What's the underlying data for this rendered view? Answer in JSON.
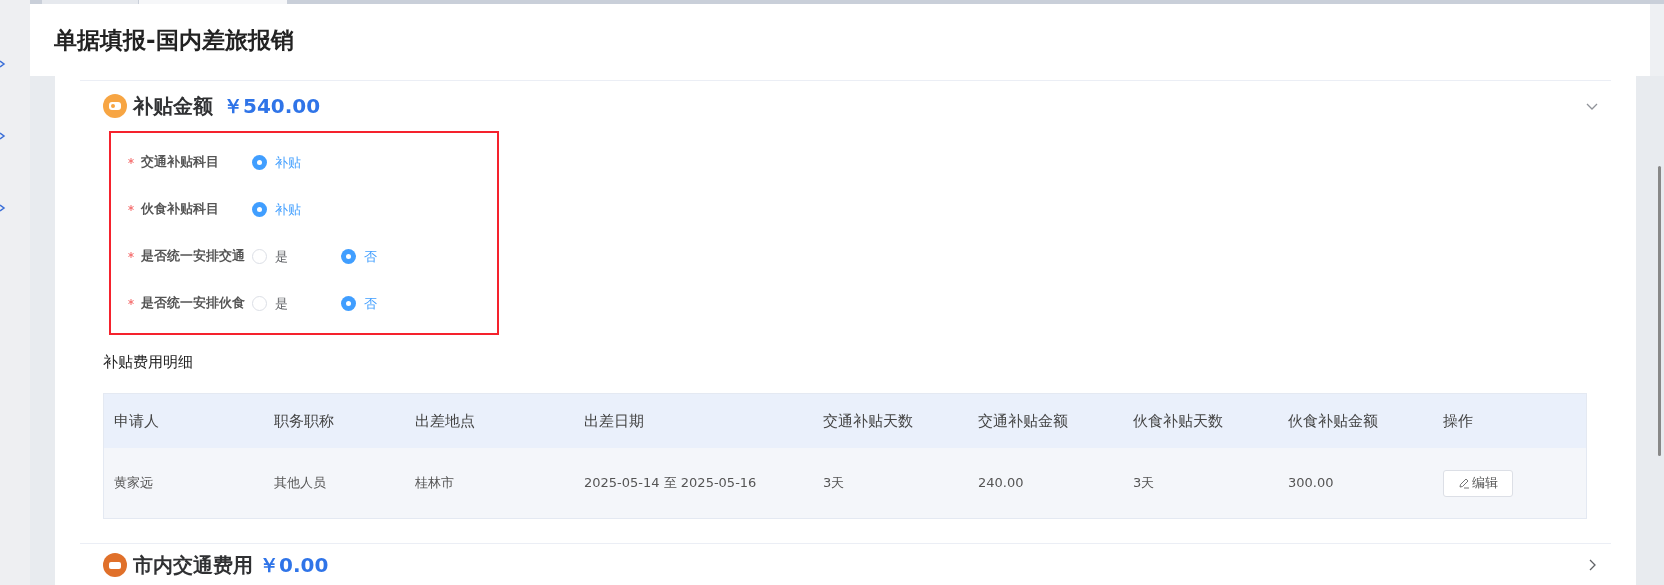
{
  "page": {
    "title": "单据填报-国内差旅报销"
  },
  "subsidy_section": {
    "title": "补贴金额",
    "amount": "￥540.00",
    "expanded": true,
    "fields_highlighted": true,
    "fields": [
      {
        "label": "交通补贴科目",
        "required": true,
        "options": [
          {
            "label": "补贴",
            "selected": true
          }
        ]
      },
      {
        "label": "伙食补贴科目",
        "required": true,
        "options": [
          {
            "label": "补贴",
            "selected": true
          }
        ]
      },
      {
        "label": "是否统一安排交通",
        "required": true,
        "options": [
          {
            "label": "是",
            "selected": false
          },
          {
            "label": "否",
            "selected": true
          }
        ]
      },
      {
        "label": "是否统一安排伙食",
        "required": true,
        "options": [
          {
            "label": "是",
            "selected": false
          },
          {
            "label": "否",
            "selected": true
          }
        ]
      }
    ],
    "detail_title": "补贴费用明细",
    "table": {
      "columns": [
        "申请人",
        "职务职称",
        "出差地点",
        "出差日期",
        "交通补贴天数",
        "交通补贴金额",
        "伙食补贴天数",
        "伙食补贴金额",
        "操作"
      ],
      "rows": [
        {
          "cells": [
            "黄家远",
            "其他人员",
            "桂林市",
            "2025-05-14 至 2025-05-16",
            "3天",
            "240.00",
            "3天",
            "300.00"
          ],
          "action": "编辑"
        }
      ]
    }
  },
  "next_section": {
    "title": "市内交通费用",
    "amount": "￥0.00",
    "expanded": false
  }
}
